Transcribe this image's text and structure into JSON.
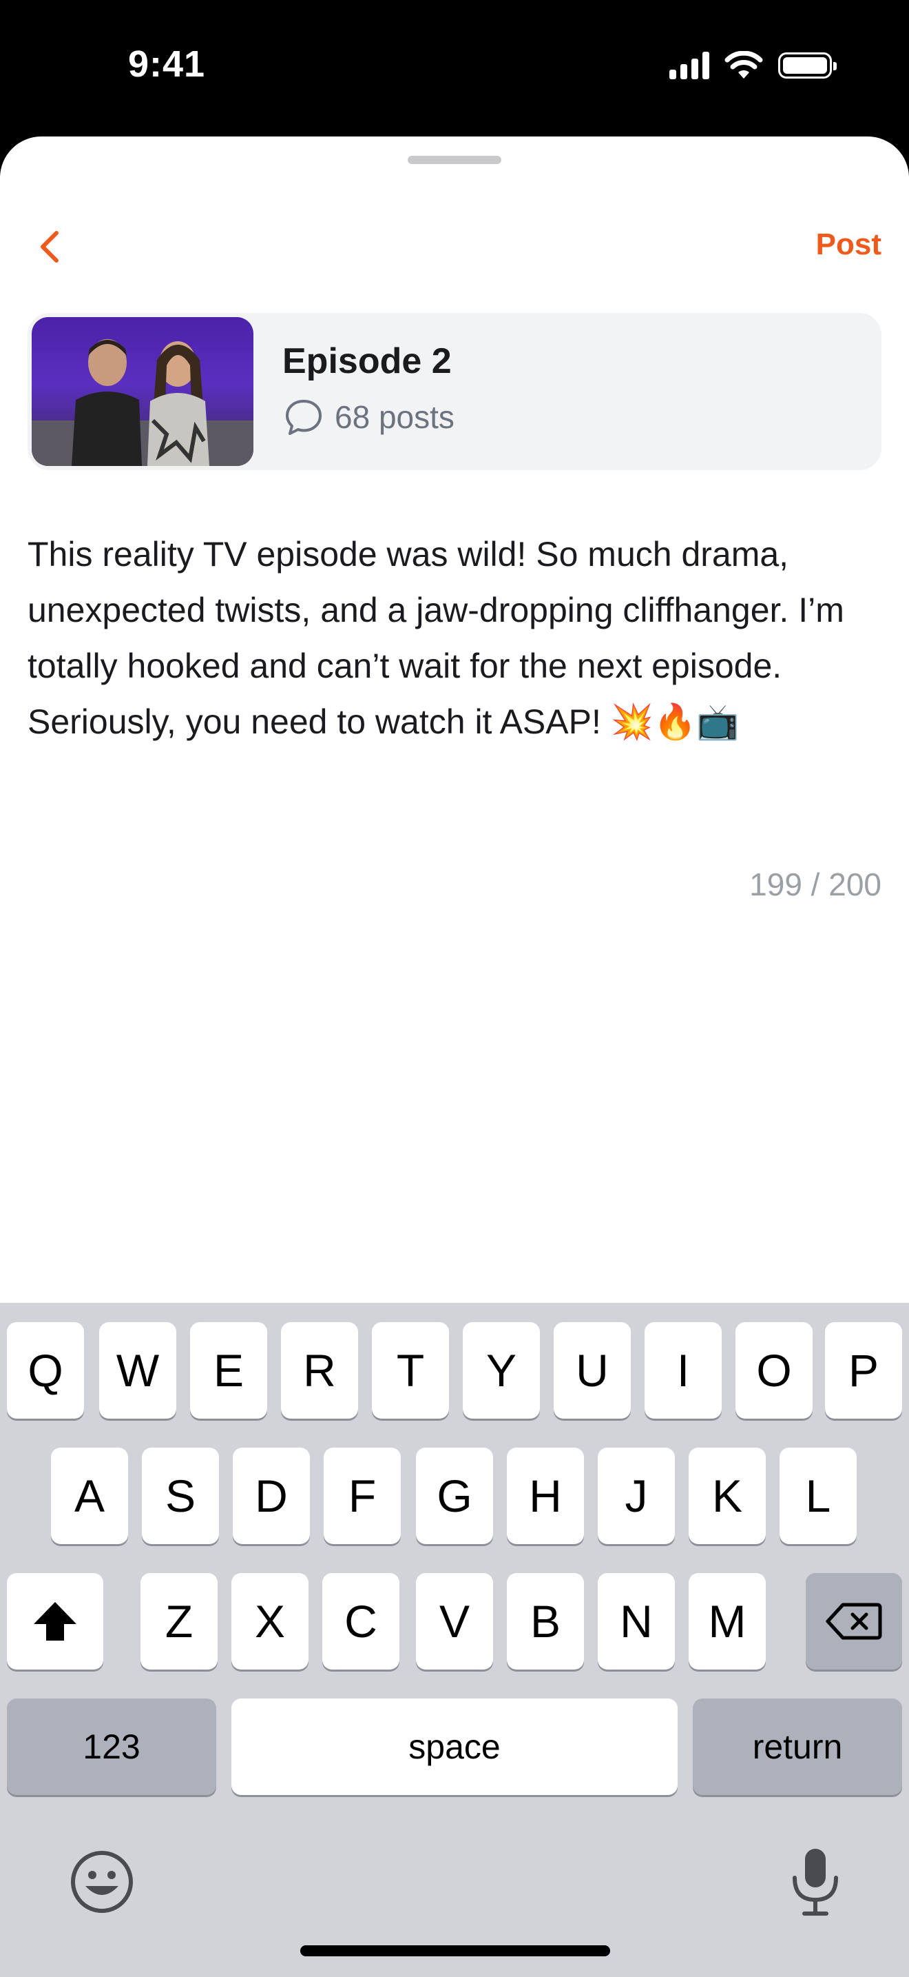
{
  "status_bar": {
    "time": "9:41"
  },
  "header": {
    "post_label": "Post"
  },
  "episode": {
    "title": "Episode 2",
    "posts_count": "68 posts"
  },
  "post": {
    "text": "This reality TV episode was wild! So much drama, unexpected twists, and a jaw-dropping cliffhanger. I’m totally hooked and can’t wait for the next episode. Seriously, you need to watch it ASAP! 💥🔥📺",
    "char_count": "199 / 200"
  },
  "keyboard": {
    "row1": [
      "Q",
      "W",
      "E",
      "R",
      "T",
      "Y",
      "U",
      "I",
      "O",
      "P"
    ],
    "row2": [
      "A",
      "S",
      "D",
      "F",
      "G",
      "H",
      "J",
      "K",
      "L"
    ],
    "row3": [
      "Z",
      "X",
      "C",
      "V",
      "B",
      "N",
      "M"
    ],
    "numbers_label": "123",
    "space_label": "space",
    "return_label": "return"
  },
  "colors": {
    "accent": "#ee5a1c",
    "keyboard_bg": "#d1d3d9"
  }
}
